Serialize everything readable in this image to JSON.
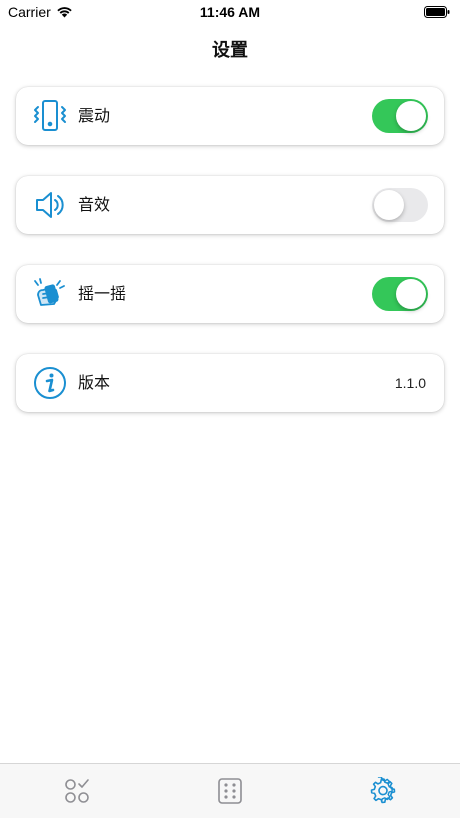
{
  "status_bar": {
    "carrier": "Carrier",
    "time": "11:46 AM",
    "wifi_icon": "wifi-icon",
    "battery_icon": "battery-icon"
  },
  "nav": {
    "title": "设置"
  },
  "settings": [
    {
      "label": "震动",
      "icon": "vibration-icon",
      "toggle_on": true
    },
    {
      "label": "音效",
      "icon": "speaker-icon",
      "toggle_on": false
    },
    {
      "label": "摇一摇",
      "icon": "shake-hand-icon",
      "toggle_on": true
    },
    {
      "label": "版本",
      "icon": "info-icon",
      "value": "1.1.0"
    }
  ],
  "tab_bar": {
    "tabs": [
      {
        "icon": "shapes-check-icon",
        "selected": false
      },
      {
        "icon": "dice-icon",
        "selected": false
      },
      {
        "icon": "gear-icon",
        "selected": true
      }
    ]
  },
  "colors": {
    "accent": "#1a8fd1",
    "toggle_on": "#34c759",
    "toggle_off": "#e9e9eb",
    "tab_inactive": "#8e8e93"
  }
}
